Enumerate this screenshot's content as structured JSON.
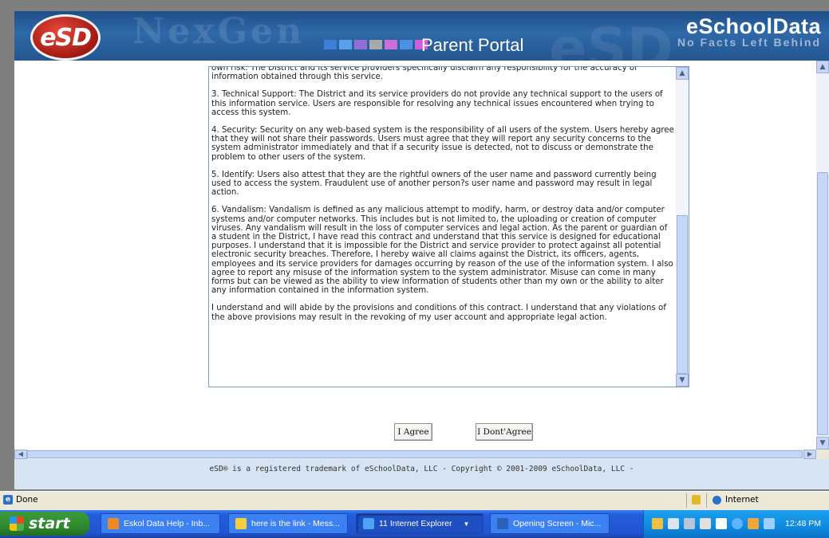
{
  "header": {
    "logo_text": "eSD",
    "watermark": "NexGen",
    "portal_title": "Parent Portal",
    "brand_name": "eSchoolData",
    "brand_tagline": "No Facts Left Behind",
    "squares": [
      "#3d7fd9",
      "#5aa0ea",
      "#8f6fd6",
      "#a9a9a9",
      "#ce6fd8",
      "#4f8fe6",
      "#d45cd8"
    ]
  },
  "contract": {
    "paragraphs": [
      "own risk.  The District and its service providers specifically disclaim any responsibility for the accuracy of information obtained through this service.",
      "3. Technical Support: The District and its service providers do not provide any technical support to the users of this information service.  Users are responsible for resolving any technical issues encountered when trying to access this system.",
      "4. Security: Security on any web-based system is the responsibility of all users of the system.  Users hereby agree that they will not share their passwords. Users must agree that they will report any security concerns to the system administrator immediately and that if a security issue is detected, not to discuss or demonstrate the problem to other users of the system.",
      "5. Identify: Users also attest that they are the rightful owners of the user name and password currently being used to access the system. Fraudulent use of another person?s user name and password may result in legal action.",
      "6. Vandalism: Vandalism is defined as any malicious attempt to modify, harm, or destroy data and/or computer systems and/or computer networks. This includes but is not limited to, the uploading or creation of computer viruses. Any vandalism will result in the loss of computer services and legal action. As the parent or guardian of a student in the District, I have read this contract and understand that this service is designed for educational purposes. I understand that it is impossible for the District and service provider to protect against all potential electronic security breaches. Therefore, I hereby waive all claims against the District, its officers, agents, employees and its service providers for damages occurring by reason of the use of the information system.  I also agree to report any misuse of the information system to the system administrator.  Misuse can come in many forms but can be viewed as the ability to view information of students other than my own or the ability to alter any information contained in the information system.",
      "I understand and will abide by the provisions and conditions of this contract. I understand that any violations of the above provisions may result in the revoking of my user account and appropriate legal action."
    ]
  },
  "buttons": {
    "agree": "I Agree",
    "disagree": "I Dont'Agree"
  },
  "footer": {
    "copyright": "eSD® is a registered trademark of eSchoolData, LLC - Copyright © 2001-2009 eSchoolData, LLC -"
  },
  "statusbar": {
    "status": "Done",
    "zone": "Internet"
  },
  "taskbar": {
    "start_label": "start",
    "tasks": [
      {
        "label": "Eskol Data Help - Inb...",
        "icon_color": "#f08a24"
      },
      {
        "label": "here is the link - Mess...",
        "icon_color": "#f4d03f"
      },
      {
        "label": "11 Internet Explorer",
        "icon_color": "#4fa3f7"
      },
      {
        "label": "Opening Screen - Mic...",
        "icon_color": "#2b5fb8"
      }
    ],
    "clock": "12:48 PM"
  }
}
